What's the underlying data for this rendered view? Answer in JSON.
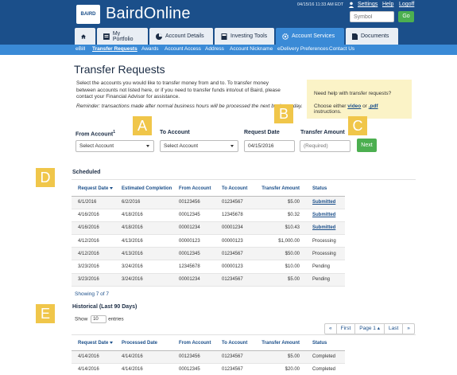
{
  "header": {
    "logo_text": "BAIRD",
    "brand": "BairdOnline",
    "datetime": "04/15/16 11:33 AM EDT",
    "links": {
      "settings": "Settings",
      "help": "Help",
      "logoff": "Logoff"
    },
    "symbol_placeholder": "Symbol",
    "go_label": "Go"
  },
  "tabs": [
    {
      "label": ""
    },
    {
      "label": "My Portfolio"
    },
    {
      "label": "Account Details"
    },
    {
      "label": "Investing Tools"
    },
    {
      "label": "Account Services"
    },
    {
      "label": "Documents"
    }
  ],
  "subnav": [
    "eBill",
    "Transfer Requests",
    "Awards",
    "Account Access",
    "Address",
    "Account Nickname",
    "eDelivery Preferences",
    "Contact Us"
  ],
  "page": {
    "title": "Transfer Requests",
    "intro": "Select the accounts you would like to transfer money from and to. To transfer money between accounts not listed here, or if you need to transfer funds into/out of Baird, please contact your Financial Advisor for assistance.",
    "reminder": "Reminder: transactions made after normal business hours will be processed the next business day."
  },
  "help": {
    "line1": "Need help with transfer requests?",
    "line2_prefix": "Choose either ",
    "video": "video",
    "or": " or ",
    "pdf": ".pdf",
    "line2_suffix": " instructions."
  },
  "badges": {
    "a": "A",
    "b": "B",
    "c": "C",
    "d": "D",
    "e": "E"
  },
  "form": {
    "from_label": "From Account",
    "from_sup": "1",
    "to_label": "To Account",
    "date_label": "Request Date",
    "amount_label": "Transfer Amount",
    "from_value": "Select Account",
    "to_value": "Select Account",
    "date_value": "04/15/2016",
    "amount_placeholder": "(Required)",
    "next_label": "Next"
  },
  "scheduled": {
    "title": "Scheduled",
    "headers": [
      "Request Date",
      "Estimated Completion",
      "From Account",
      "To Account",
      "Transfer Amount",
      "Status"
    ],
    "rows": [
      [
        "6/1/2016",
        "6/2/2016",
        "00123456",
        "01234567",
        "$5.00",
        "Submitted"
      ],
      [
        "4/16/2016",
        "4/18/2016",
        "00012345",
        "12345678",
        "$0.32",
        "Submitted"
      ],
      [
        "4/16/2016",
        "4/18/2016",
        "00001234",
        "00001234",
        "$10.43",
        "Submitted"
      ],
      [
        "4/12/2016",
        "4/13/2016",
        "00000123",
        "00000123",
        "$1,000.00",
        "Processing"
      ],
      [
        "4/12/2016",
        "4/13/2016",
        "00012345",
        "01234567",
        "$50.00",
        "Processing"
      ],
      [
        "3/23/2016",
        "3/24/2016",
        "12345678",
        "00000123",
        "$10.00",
        "Pending"
      ],
      [
        "3/23/2016",
        "3/24/2016",
        "00001234",
        "01234567",
        "$5.00",
        "Pending"
      ]
    ],
    "showing": "Showing 7 of 7"
  },
  "historical": {
    "title": "Historical (Last 90 Days)",
    "show_prefix": "Show",
    "show_value": "10",
    "show_suffix": "entries",
    "pager": {
      "first": "First",
      "page": "Page",
      "page_num": "1",
      "last": "Last"
    },
    "headers": [
      "Request Date",
      "Processed Date",
      "From Account",
      "To Account",
      "Transfer Amount",
      "Status"
    ],
    "rows": [
      [
        "4/14/2016",
        "4/14/2016",
        "00123456",
        "01234567",
        "$5.00",
        "Completed"
      ],
      [
        "4/14/2016",
        "4/14/2016",
        "00012345",
        "01234567",
        "$20.00",
        "Completed"
      ]
    ]
  },
  "colors": {
    "header": "#1b4f8a",
    "subnav": "#3a8ad6",
    "accent_green": "#4caf50",
    "badge": "#f0c64a",
    "help_bg": "#fbf3c7"
  }
}
